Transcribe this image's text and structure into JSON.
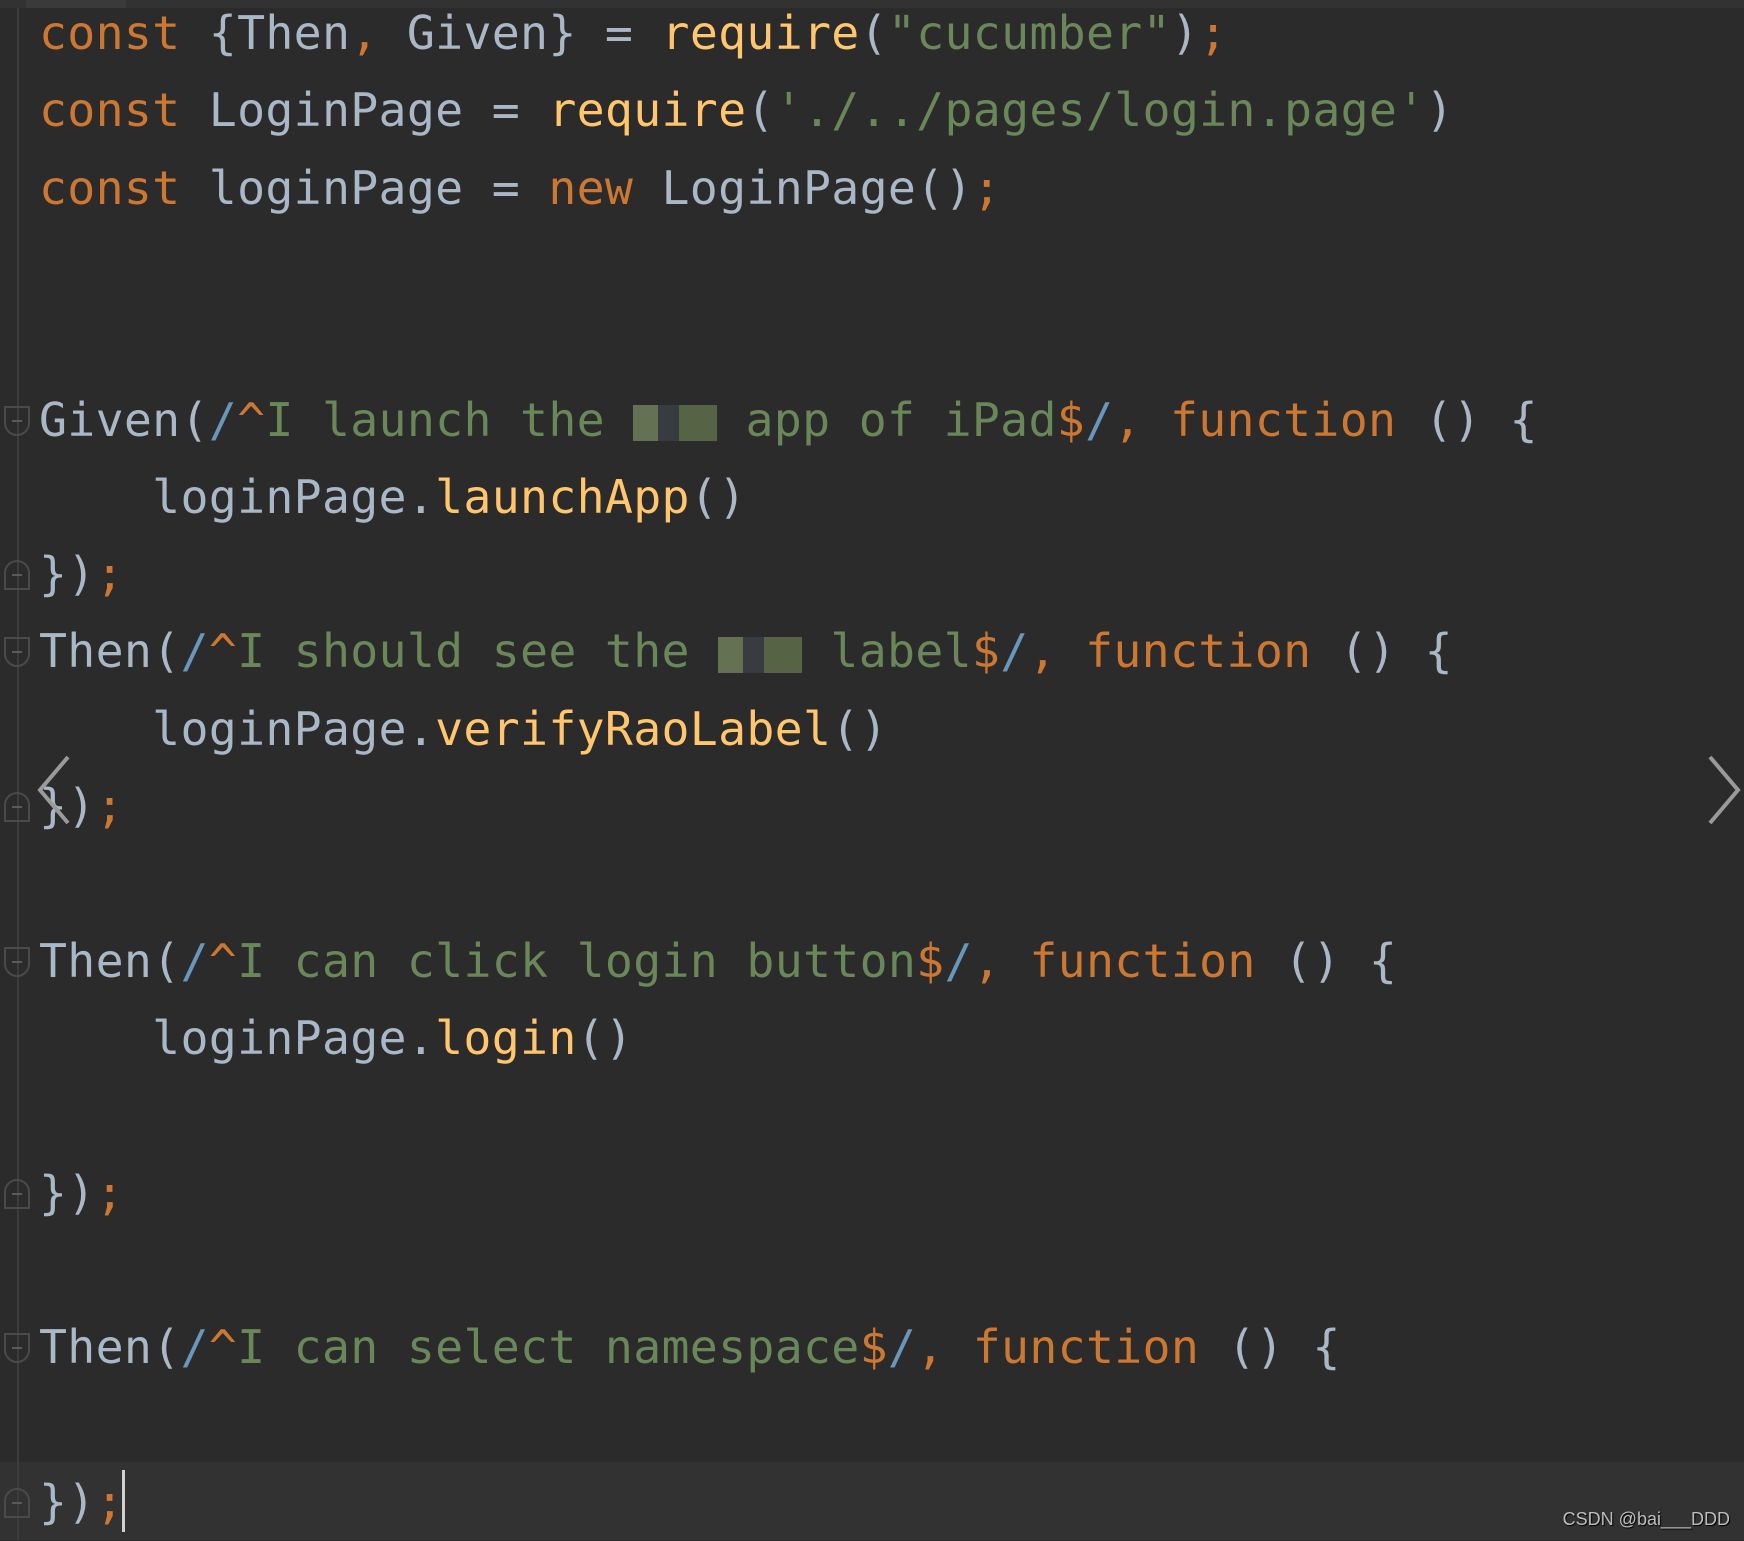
{
  "editor": {
    "colors": {
      "background": "#2b2b2b",
      "keyword": "#cc7832",
      "identifier": "#a9b7c6",
      "function": "#ffc66d",
      "string": "#6a8759",
      "regex": "#6897bb"
    },
    "current_line": 19,
    "lines": [
      [
        [
          "kw",
          "const "
        ],
        [
          "id",
          "{Then"
        ],
        [
          "punc",
          ","
        ],
        [
          "id",
          " Given} = "
        ],
        [
          "fn",
          "require"
        ],
        [
          "id",
          "("
        ],
        [
          "str",
          "\"cucumber\""
        ],
        [
          "id",
          ")"
        ],
        [
          "punc",
          ";"
        ]
      ],
      [
        [
          "kw",
          "const "
        ],
        [
          "id",
          "LoginPage = "
        ],
        [
          "fn",
          "require"
        ],
        [
          "id",
          "("
        ],
        [
          "str",
          "'./../pages/login.page'"
        ],
        [
          "id",
          ")"
        ]
      ],
      [
        [
          "kw",
          "const "
        ],
        [
          "id",
          "loginPage = "
        ],
        [
          "kw",
          "new "
        ],
        [
          "id",
          "LoginPage()"
        ],
        [
          "punc",
          ";"
        ]
      ],
      [],
      [],
      [
        [
          "id",
          "Given("
        ],
        [
          "rx",
          "/"
        ],
        [
          "kw",
          "^"
        ],
        [
          "str",
          "I launch the "
        ],
        [
          "red",
          ""
        ],
        [
          "str",
          " app of iPad"
        ],
        [
          "kw",
          "$"
        ],
        [
          "rx",
          "/"
        ],
        [
          "punc",
          ", "
        ],
        [
          "kw",
          "function "
        ],
        [
          "id",
          "() {"
        ]
      ],
      [
        [
          "id",
          "    loginPage."
        ],
        [
          "fn",
          "launchApp"
        ],
        [
          "id",
          "()"
        ]
      ],
      [
        [
          "id",
          "})"
        ],
        [
          "punc",
          ";"
        ]
      ],
      [
        [
          "id",
          "Then("
        ],
        [
          "rx",
          "/"
        ],
        [
          "kw",
          "^"
        ],
        [
          "str",
          "I should see the "
        ],
        [
          "red",
          ""
        ],
        [
          "str",
          " label"
        ],
        [
          "kw",
          "$"
        ],
        [
          "rx",
          "/"
        ],
        [
          "punc",
          ", "
        ],
        [
          "kw",
          "function "
        ],
        [
          "id",
          "() {"
        ]
      ],
      [
        [
          "id",
          "    loginPage."
        ],
        [
          "fn",
          "verifyRaoLabel"
        ],
        [
          "id",
          "()"
        ]
      ],
      [
        [
          "id",
          "})"
        ],
        [
          "punc",
          ";"
        ]
      ],
      [],
      [
        [
          "id",
          "Then("
        ],
        [
          "rx",
          "/"
        ],
        [
          "kw",
          "^"
        ],
        [
          "str",
          "I can click login button"
        ],
        [
          "kw",
          "$"
        ],
        [
          "rx",
          "/"
        ],
        [
          "punc",
          ", "
        ],
        [
          "kw",
          "function "
        ],
        [
          "id",
          "() {"
        ]
      ],
      [
        [
          "id",
          "    loginPage."
        ],
        [
          "fn",
          "login"
        ],
        [
          "id",
          "()"
        ]
      ],
      [],
      [
        [
          "id",
          "})"
        ],
        [
          "punc",
          ";"
        ]
      ],
      [],
      [
        [
          "id",
          "Then("
        ],
        [
          "rx",
          "/"
        ],
        [
          "kw",
          "^"
        ],
        [
          "str",
          "I can select namespace"
        ],
        [
          "kw",
          "$"
        ],
        [
          "rx",
          "/"
        ],
        [
          "punc",
          ", "
        ],
        [
          "kw",
          "function "
        ],
        [
          "id",
          "() {"
        ]
      ],
      [],
      [
        [
          "id",
          "})"
        ],
        [
          "punc",
          ";"
        ]
      ]
    ],
    "fold_open_lines": [
      5,
      8,
      12,
      17
    ],
    "fold_close_lines": [
      7,
      10,
      15,
      19
    ]
  },
  "icons": {
    "prev": "chevron-left-icon",
    "next": "chevron-right-icon"
  },
  "watermark": "CSDN @bai___DDD"
}
